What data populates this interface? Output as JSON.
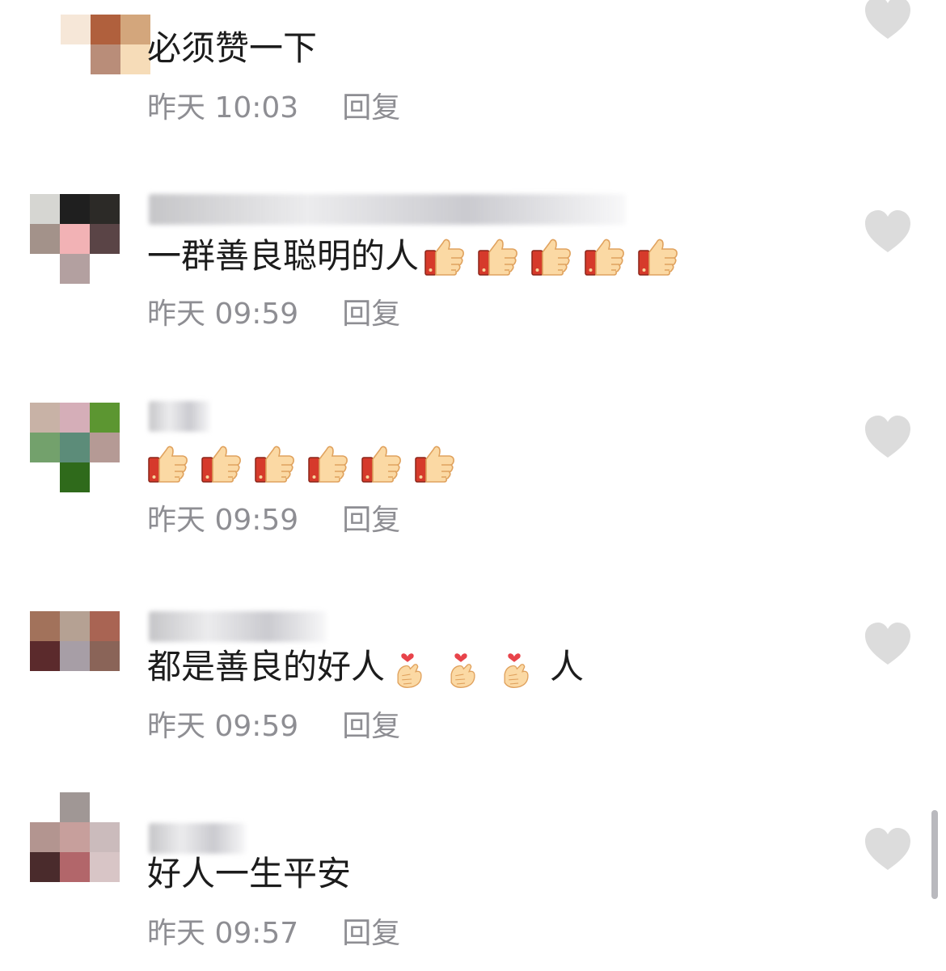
{
  "comments": [
    {
      "text": "必须赞一下",
      "emoji": [],
      "emoji_after": "",
      "time": "昨天 10:03",
      "reply_label": "回复",
      "name_blurred": false,
      "avatar_colors": [
        "#f6e7d8",
        "#b0603d",
        "#d3a67c",
        "#ffffff",
        "#b98d79",
        "#f6dcb8"
      ]
    },
    {
      "text": "一群善良聪明的人",
      "emoji": [
        "thumbs-up",
        "thumbs-up",
        "thumbs-up",
        "thumbs-up",
        "thumbs-up"
      ],
      "emoji_after": "",
      "time": "昨天 09:59",
      "reply_label": "回复",
      "name_blurred": true,
      "avatar_colors": [
        "#d6d6d2",
        "#1f1f1f",
        "#2c2a27",
        "#a3928a",
        "#f2b2b5",
        "#5a4446",
        "#ffffff",
        "#b3a0a0",
        "#ffffff"
      ]
    },
    {
      "text": "",
      "emoji": [
        "thumbs-up",
        "thumbs-up",
        "thumbs-up",
        "thumbs-up",
        "thumbs-up",
        "thumbs-up"
      ],
      "emoji_after": "",
      "time": "昨天 09:59",
      "reply_label": "回复",
      "name_blurred": true,
      "avatar_colors": [
        "#c8b2a6",
        "#d5aeb8",
        "#5c9631",
        "#73a16c",
        "#5c8c79",
        "#b59a95",
        "#ffffff",
        "#2f6a1b",
        "#ffffff"
      ]
    },
    {
      "text": "都是善良的好人",
      "emoji": [
        "finger-heart",
        "finger-heart",
        "finger-heart"
      ],
      "emoji_after": "人",
      "time": "昨天 09:59",
      "reply_label": "回复",
      "name_blurred": true,
      "avatar_colors": [
        "#a2725b",
        "#b5a193",
        "#a96453",
        "#5b2a2c",
        "#a79ea6",
        "#8a6458",
        "#ffffff",
        "#ffffff",
        "#ffffff"
      ]
    },
    {
      "text": "好人一生平安",
      "emoji": [],
      "emoji_after": "",
      "time": "昨天 09:57",
      "reply_label": "回复",
      "name_blurred": true,
      "avatar_colors": [
        "#ffffff",
        "#a09795",
        "#ffffff",
        "#b39590",
        "#c79f9c",
        "#cbbbbc",
        "#4a2b2c",
        "#b2666a",
        "#d8c5c6"
      ]
    }
  ],
  "colors": {
    "text": "#1c1c1c",
    "meta": "#8e8e93",
    "like_heart": "#dcdcdc"
  },
  "icons": {
    "like": "heart-icon",
    "thumbs": "thumbs-up-emoji",
    "heart_hand": "finger-heart-emoji"
  }
}
